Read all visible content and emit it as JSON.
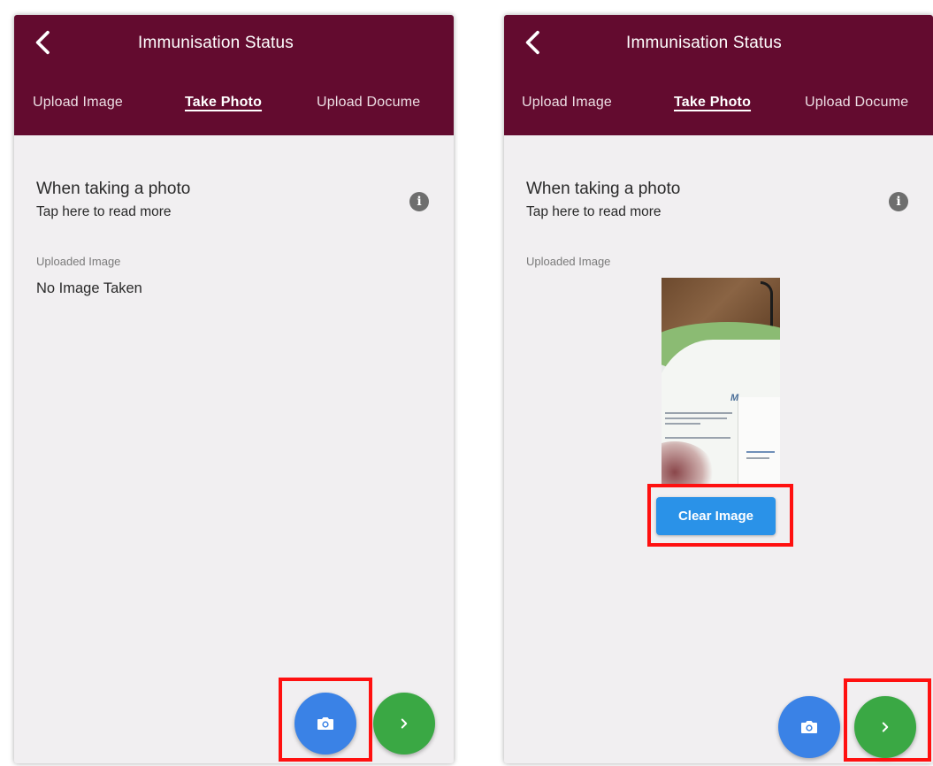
{
  "screens": [
    {
      "header": {
        "title": "Immunisation Status"
      },
      "tabs": [
        {
          "label": "Upload Image",
          "active": false
        },
        {
          "label": "Take Photo",
          "active": true
        },
        {
          "label": "Upload Docume",
          "active": false
        }
      ],
      "info": {
        "title": "When taking a photo",
        "subtitle": "Tap here to read more",
        "icon": "info-icon"
      },
      "uploaded": {
        "label": "Uploaded Image",
        "status_text": "No Image Taken"
      },
      "fabs": [
        {
          "icon": "camera-icon"
        },
        {
          "icon": "chevron-right-icon"
        }
      ]
    },
    {
      "header": {
        "title": "Immunisation Status"
      },
      "tabs": [
        {
          "label": "Upload Image",
          "active": false
        },
        {
          "label": "Take Photo",
          "active": true
        },
        {
          "label": "Upload Docume",
          "active": false
        }
      ],
      "info": {
        "title": "When taking a photo",
        "subtitle": "Tap here to read more",
        "icon": "info-icon"
      },
      "uploaded": {
        "label": "Uploaded Image",
        "clear_button": "Clear Image"
      },
      "fabs": [
        {
          "icon": "camera-icon"
        },
        {
          "icon": "chevron-right-icon"
        }
      ]
    }
  ],
  "colors": {
    "header": "#630b2f",
    "camera_fab": "#3a82e6",
    "next_fab": "#3aa844",
    "clear_button": "#2a92e8",
    "highlight": "#ff1010",
    "background": "#f1eff1"
  }
}
